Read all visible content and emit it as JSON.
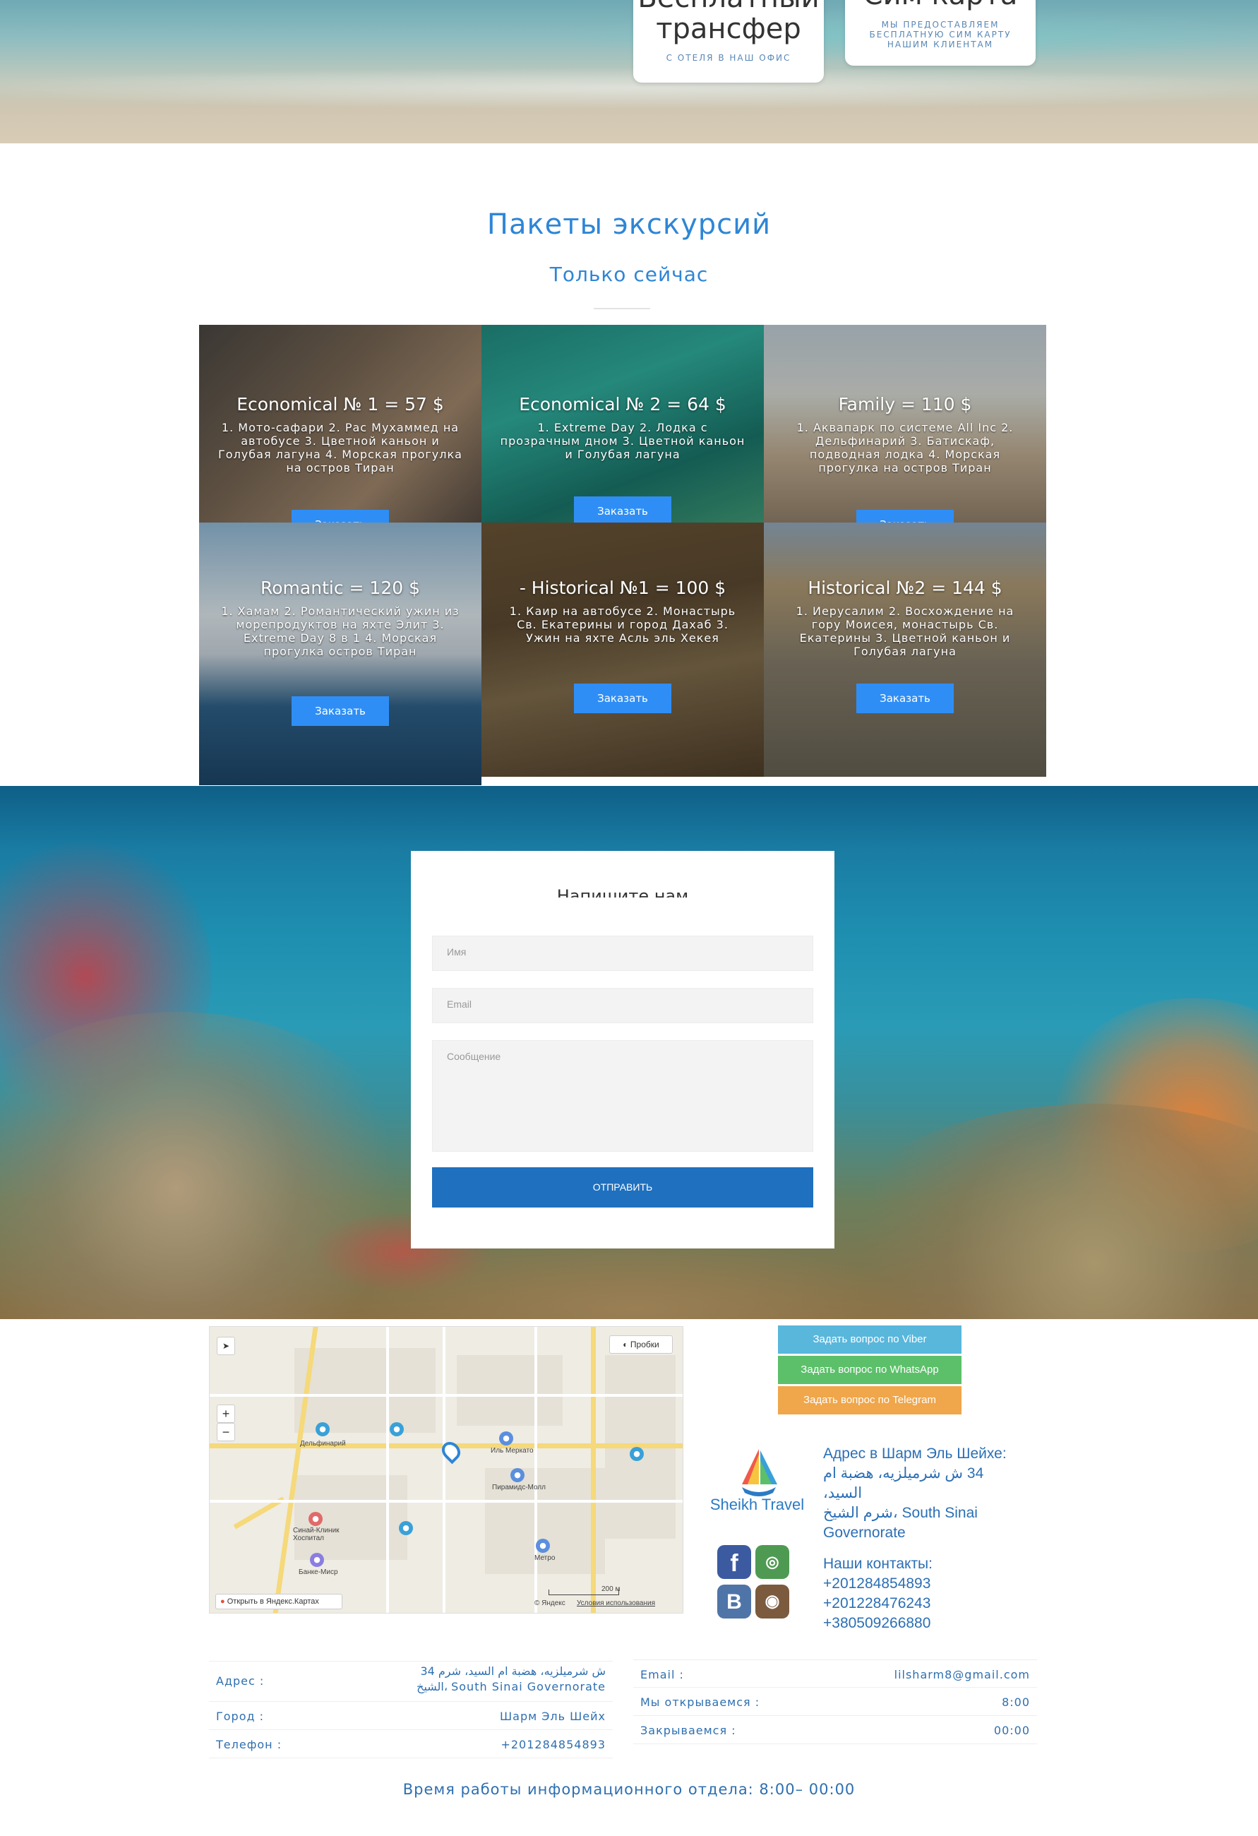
{
  "hero": {
    "card1": {
      "title_line1": "Бесплатный",
      "title_line2": "трансфер",
      "subtitle": "с отеля в наш офис"
    },
    "card2": {
      "title": "Сим карта",
      "subtitle": "мы предоставляем бесплатную сим карту нашим клиентам"
    }
  },
  "tours_section": {
    "title": "Пакеты экскурсий",
    "subtitle": "Только сейчас",
    "tours": [
      {
        "title": "Economical № 1 = 57 $",
        "desc": "1. Мото-сафари 2. Рас Мухаммед на автобусе 3. Цветной каньон и Голубая лагуна 4. Морская прогулка на остров Тиран",
        "button": "Заказать"
      },
      {
        "title": "Economical № 2 = 64 $",
        "desc": "1. Extreme Day 2. Лодка с прозрачным дном 3. Цветной каньон и Голубая лагуна",
        "button": "Заказать"
      },
      {
        "title": "Family = 110 $",
        "desc": "1. Аквапарк по системе All Inc 2. Дельфинарий 3. Батискаф, подводная лодка 4. Морская прогулка на остров Тиран",
        "button": "Заказать"
      },
      {
        "title": "Romantic = 120 $",
        "desc": "1. Хамам 2. Романтический ужин из морепродуктов на яхте Элит 3. Extreme Day 8 в 1 4. Морская прогулка остров Тиран",
        "button": "Заказать"
      },
      {
        "title": "- Historical №1 = 100 $",
        "desc": "1. Каир на автобусе 2. Монастырь Св. Екатерины и город Дахаб 3. Ужин на яхте Асль эль Хекея",
        "button": "Заказать"
      },
      {
        "title": "Historical №2 = 144 $",
        "desc": "1. Иерусалим 2. Восхождение на гору Моисея, монастырь Св. Екатерины 3. Цветной каньон и Голубая лагуна",
        "button": "Заказать"
      }
    ]
  },
  "contact_form": {
    "title": "Напишите нам",
    "name_placeholder": "Имя",
    "email_placeholder": "Email",
    "message_placeholder": "Сообщение",
    "submit_label": "Отправить"
  },
  "map": {
    "traffic_label": "Пробки",
    "zoom_in": "+",
    "zoom_out": "−",
    "labels": {
      "dolphinarium": "Дельфинарий",
      "il_mercato": "Иль Меркато",
      "pyramids_mall": "Пирамидс-Молл",
      "sinai_clinic": "Синай-Клиник Хоспитал",
      "bank_misr": "Банке-Миср",
      "metro": "Метро"
    },
    "scale": "200 м",
    "open_link": "Открыть в Яндекс.Картах",
    "copyright": "© Яндекс",
    "terms": "Условия использования"
  },
  "chat_buttons": {
    "viber": "Задать вопрос по Viber",
    "whatsapp": "Задать вопрос по WhatsApp",
    "telegram": "Задать вопрос по Telegram"
  },
  "brand": {
    "name": "Sheikh Travel"
  },
  "address_block": {
    "heading": "Адрес в Шарм Эль Шейхе:",
    "line1": "34 ش شرميلزيه، هضبة ام السيد،",
    "line2": "شرم الشيخ، South Sinai Governorate",
    "contacts_heading": "Наши контакты:",
    "phones": [
      "+201284854893",
      "+201228476243",
      "+380509266880"
    ]
  },
  "info_table": {
    "left": [
      {
        "key": "Адрес :",
        "value_line1": "34 ش شرميلزيه، هضبة ام السيد، شرم",
        "value_line2": "الشيخ، South Sinai Governorate"
      },
      {
        "key": "Город :",
        "value": "Шарм Эль Шейх"
      },
      {
        "key": "Телефон :",
        "value": "+201284854893"
      }
    ],
    "right": [
      {
        "key": "Email :",
        "value": "lilsharm8@gmail.com"
      },
      {
        "key": "Мы открываемся :",
        "value": "8:00"
      },
      {
        "key": "Закрываемся :",
        "value": "00:00"
      }
    ]
  },
  "footer": {
    "hours": "Время работы информационного отдела: 8:00– 00:00"
  },
  "colors": {
    "accent": "#2e86d6",
    "button": "#2f8ef5",
    "submit": "#1f70bf",
    "viber": "#59b7dc",
    "whatsapp": "#5cc06a",
    "telegram": "#f0a64a"
  }
}
